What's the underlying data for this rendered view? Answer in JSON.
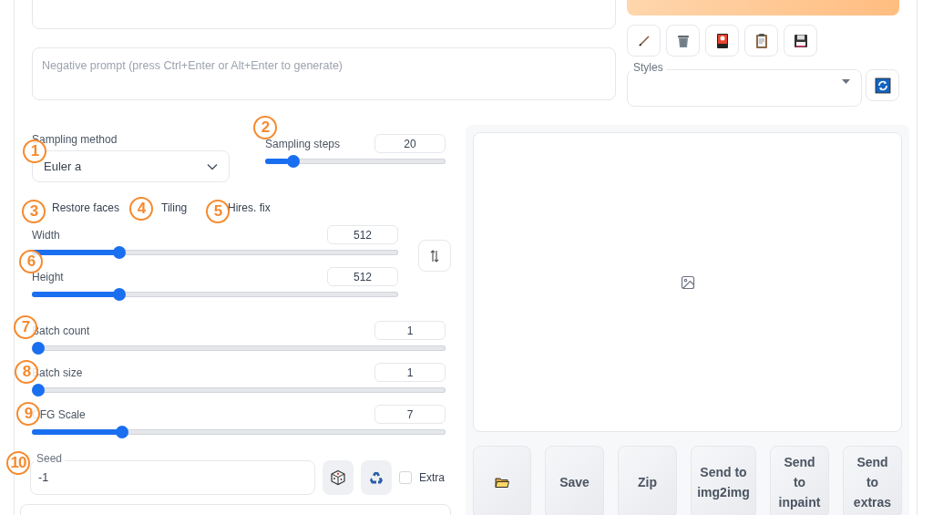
{
  "negative_prompt": {
    "placeholder": "Negative prompt (press Ctrl+Enter or Alt+Enter to generate)"
  },
  "styles": {
    "label": "Styles"
  },
  "sampling_method": {
    "label": "Sampling method",
    "value": "Euler a"
  },
  "sampling_steps": {
    "label": "Sampling steps",
    "value": "20",
    "level": 0.13
  },
  "checkboxes": [
    {
      "label": "Restore faces"
    },
    {
      "label": "Tiling"
    },
    {
      "label": "Hires. fix"
    }
  ],
  "dimension_sliders": [
    {
      "label": "Width",
      "value": "512",
      "level": 0.23
    },
    {
      "label": "Height",
      "value": "512",
      "level": 0.23
    }
  ],
  "batch_sliders": [
    {
      "label": "Batch count",
      "value": "1",
      "level": 0
    },
    {
      "label": "Batch size",
      "value": "1",
      "level": 0
    },
    {
      "label": "CFG Scale",
      "value": "7",
      "level": 0.21
    }
  ],
  "seed": {
    "label": "Seed",
    "value": "-1",
    "extra": {
      "label": "Extra",
      "checked": false
    }
  },
  "gallery_buttons": [
    {
      "kind": "folder"
    },
    {
      "kind": "text",
      "label": "Save"
    },
    {
      "kind": "text",
      "label": "Zip"
    },
    {
      "kind": "text",
      "label": "Send to img2img"
    },
    {
      "kind": "text",
      "label": "Send to inpaint"
    },
    {
      "kind": "text",
      "label": "Send to extras"
    }
  ],
  "annotations": [
    {
      "label": "1"
    },
    {
      "label": "2"
    },
    {
      "label": "3"
    },
    {
      "label": "4"
    },
    {
      "label": "5"
    },
    {
      "label": "6"
    },
    {
      "label": "7"
    },
    {
      "label": "8"
    },
    {
      "label": "9"
    },
    {
      "label": "10"
    }
  ]
}
